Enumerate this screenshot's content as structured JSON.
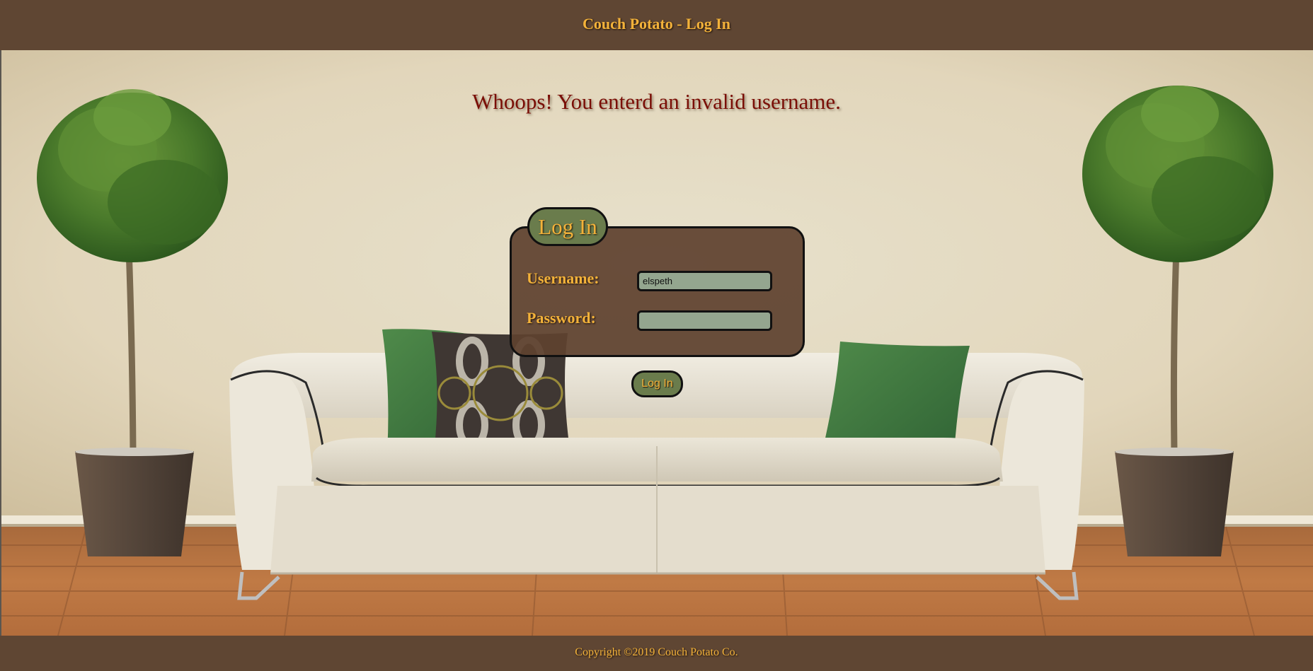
{
  "header": {
    "title": "Couch Potato - Log In"
  },
  "alert": {
    "message": "Whoops! You enterd an invalid username."
  },
  "login_form": {
    "legend": "Log In",
    "username_label": "Username:",
    "username_value": "elspeth",
    "password_label": "Password:",
    "password_value": "",
    "submit_label": "Log In"
  },
  "footer": {
    "copyright": "Copyright ©2019 Couch Potato Co."
  },
  "colors": {
    "bar_brown": "#5f4633",
    "accent_gold": "#f3b23a",
    "error_red": "#7a0e06",
    "panel_brown": "#5f422f",
    "legend_green": "#6a7c4c",
    "input_green": "#94a68f"
  },
  "background": {
    "scene": "living room with white sofa, green and patterned cushions, two potted topiary trees, wooden floor"
  }
}
